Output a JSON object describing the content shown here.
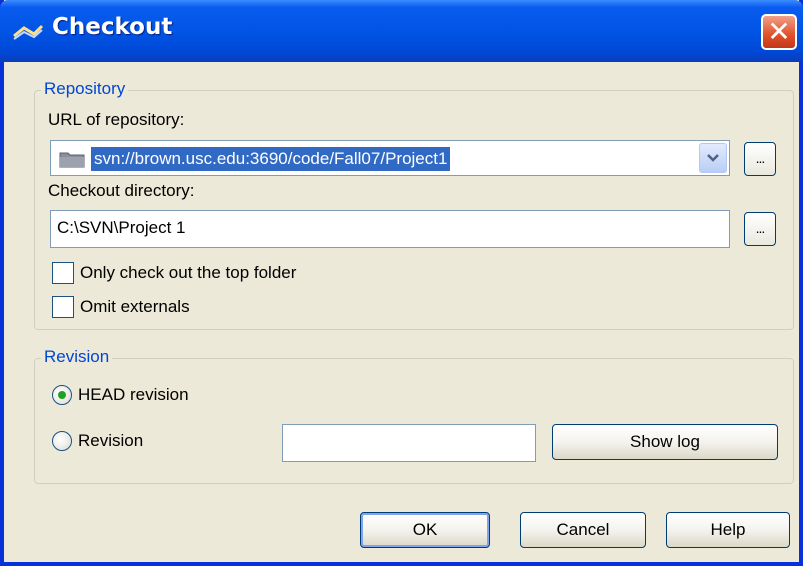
{
  "window": {
    "title": "Checkout",
    "icon": "svn-checkout-icon",
    "close_glyph": "✕"
  },
  "repository": {
    "group_label": "Repository",
    "url_label": "URL of repository:",
    "url_value": "svn://brown.usc.edu:3690/code/Fall07/Project1",
    "url_browse_label": "...",
    "dir_label": "Checkout directory:",
    "dir_value": "C:\\SVN\\Project 1",
    "dir_browse_label": "...",
    "only_top_folder_label": "Only check out the top folder",
    "only_top_folder_checked": false,
    "omit_externals_label": "Omit externals",
    "omit_externals_checked": false
  },
  "revision": {
    "group_label": "Revision",
    "head_label": "HEAD revision",
    "head_selected": true,
    "revision_label": "Revision",
    "revision_selected": false,
    "revision_value": "",
    "show_log_label": "Show log"
  },
  "buttons": {
    "ok": "OK",
    "cancel": "Cancel",
    "help": "Help"
  },
  "colors": {
    "titlebar": "#0055E5",
    "dialog_bg": "#ECE9D8",
    "group_label": "#0046D5",
    "selection": "#316AC5",
    "close_button": "#E0502A"
  }
}
